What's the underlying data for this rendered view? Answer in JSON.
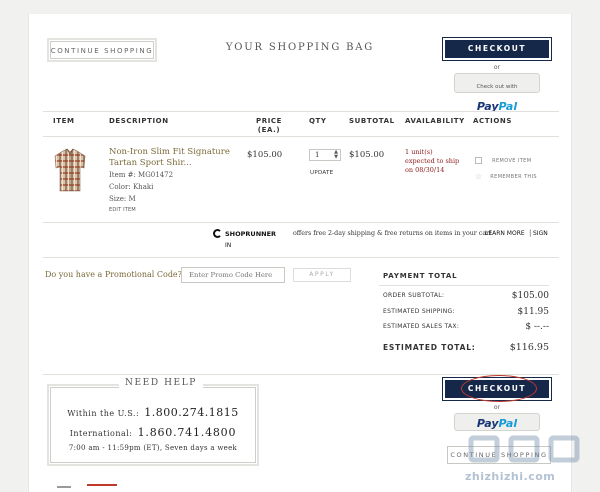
{
  "header": {
    "continue_shopping": "CONTINUE SHOPPING",
    "title": "YOUR SHOPPING BAG",
    "checkout": "CHECKOUT",
    "or": "or",
    "paypal_prefix": "Check out with",
    "paypal_pay": "Pay",
    "paypal_pal": "Pal"
  },
  "table": {
    "headers": {
      "item": "ITEM",
      "description": "DESCRIPTION",
      "price": "PRICE",
      "price_unit": "(EA.)",
      "qty": "QTY",
      "subtotal": "SUBTOTAL",
      "availability": "AVAILABILITY",
      "actions": "ACTIONS"
    },
    "row": {
      "name_line1": "Non-Iron Slim Fit Signature",
      "name_line2": "Tartan Sport Shir...",
      "item_no": "Item #: MG01472",
      "color": "Color: Khaki",
      "size": "Size: M",
      "edit": "EDIT ITEM",
      "price": "$105.00",
      "qty": "1",
      "update": "UPDATE",
      "subtotal": "$105.00",
      "availability_line1": "1 unit(s)",
      "availability_line2": "expected to ship",
      "availability_line3": "on 08/30/14",
      "remove": "REMOVE ITEM",
      "remember": "REMEMBER THIS"
    }
  },
  "shoprunner": {
    "brand": "SHOPRUNNER",
    "text": "offers free 2-day shipping & free returns on items in your cart",
    "learn_more": "LEARN MORE",
    "sign_in_1": "SIGN",
    "sign_in_2": "IN"
  },
  "promo": {
    "label": "Do you have a Promotional Code?",
    "placeholder": "Enter Promo Code Here",
    "apply": "APPLY"
  },
  "payment": {
    "title": "PAYMENT TOTAL",
    "order_subtotal_label": "ORDER SUBTOTAL:",
    "order_subtotal": "$105.00",
    "shipping_label": "ESTIMATED SHIPPING:",
    "shipping": "$11.95",
    "tax_label": "ESTIMATED SALES TAX:",
    "tax": "$ --.--",
    "total_label": "ESTIMATED TOTAL:",
    "total": "$116.95"
  },
  "help": {
    "title": "NEED HELP",
    "us_label": "Within the U.S.:",
    "us_phone": "1.800.274.1815",
    "intl_label": "International:",
    "intl_phone": "1.860.741.4800",
    "hours": "7:00 am - 11:59pm (ET), Seven days a week"
  },
  "footer": {
    "checkout": "CHECKOUT",
    "or": "or",
    "continue_shopping": "CONTINUE SHOPPING"
  },
  "watermark": {
    "text": "zhizhizhi.com"
  },
  "colors": {
    "navy": "#16284a",
    "product_link": "#7b6b3a",
    "availability": "#8b1a1a",
    "annotation_circle": "#c0392b"
  }
}
